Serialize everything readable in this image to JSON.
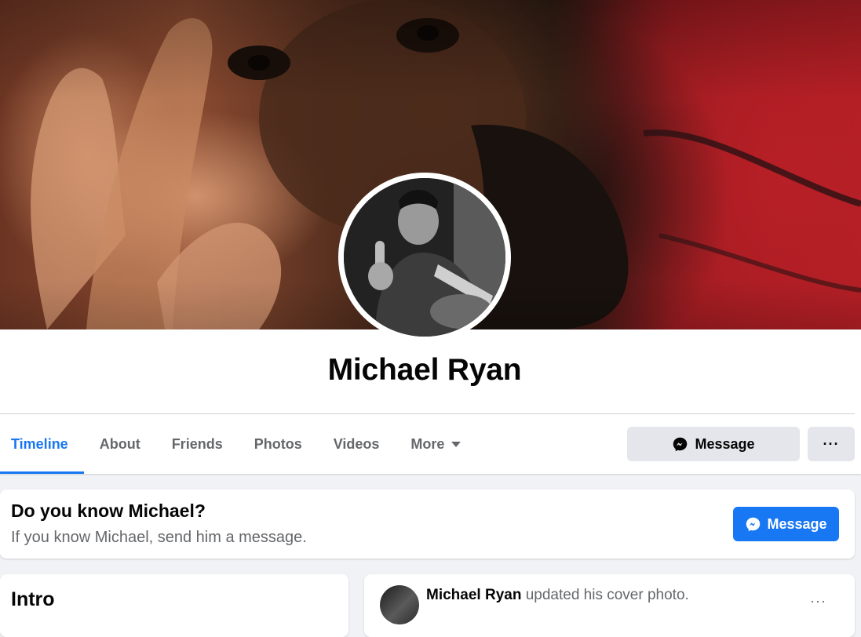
{
  "profile": {
    "name": "Michael Ryan"
  },
  "tabs": [
    {
      "label": "Timeline",
      "active": true
    },
    {
      "label": "About"
    },
    {
      "label": "Friends"
    },
    {
      "label": "Photos"
    },
    {
      "label": "Videos"
    },
    {
      "label": "More"
    }
  ],
  "actions": {
    "message_label": "Message",
    "more_label": "···"
  },
  "know_card": {
    "title": "Do you know Michael?",
    "subtitle": "If you know Michael, send him a message.",
    "button_label": "Message"
  },
  "intro": {
    "title": "Intro"
  },
  "post": {
    "author": "Michael Ryan",
    "action_text": " updated his cover photo.",
    "menu_label": "···"
  },
  "colors": {
    "accent": "#1877f2",
    "secondary_text": "#65676b",
    "button_gray": "#e4e6eb"
  },
  "icons": [
    "messenger-icon",
    "caret-down-icon",
    "more-dots-icon"
  ]
}
